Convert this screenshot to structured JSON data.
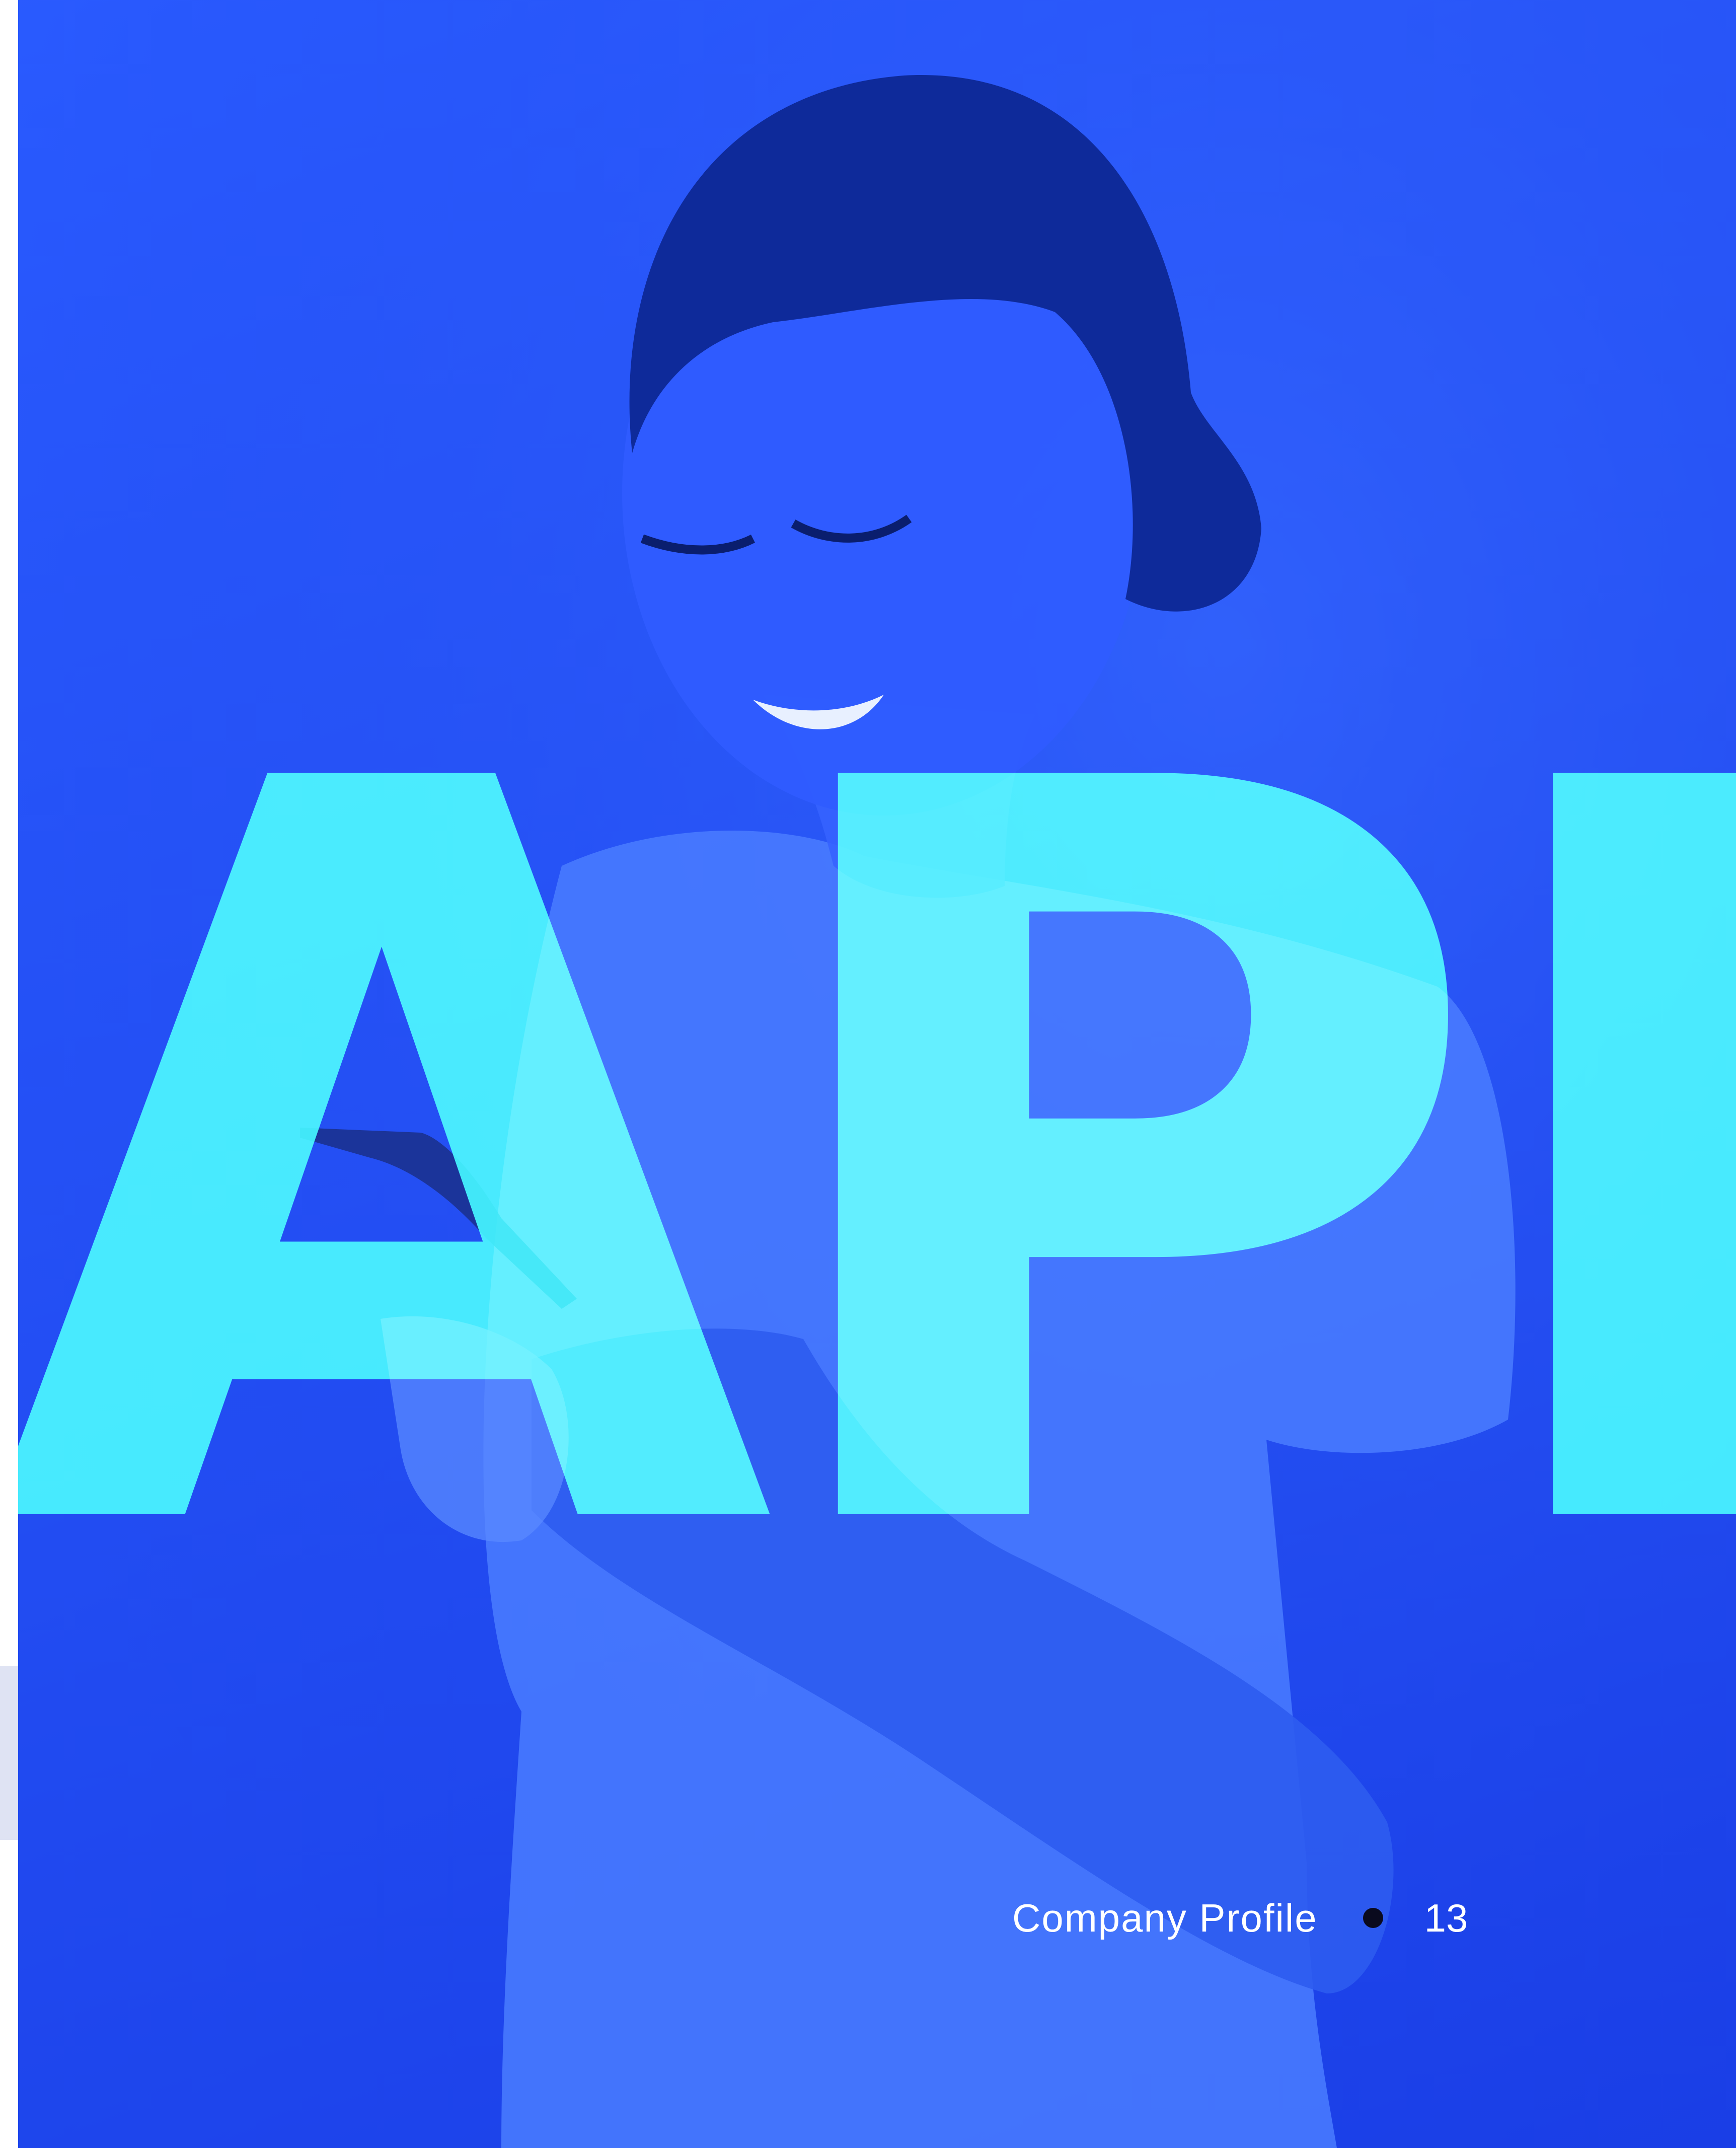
{
  "headline": "APP",
  "footer": {
    "label": "Company Profile",
    "page_number": "13"
  },
  "colors": {
    "background_blue": "#2450f5",
    "headline_cyan": "#2ef2ff",
    "footer_text": "#ffffff",
    "footer_dot": "#0a0a1e"
  },
  "image": {
    "subject": "smiling woman looking at a smartphone, blue duotone photo"
  }
}
